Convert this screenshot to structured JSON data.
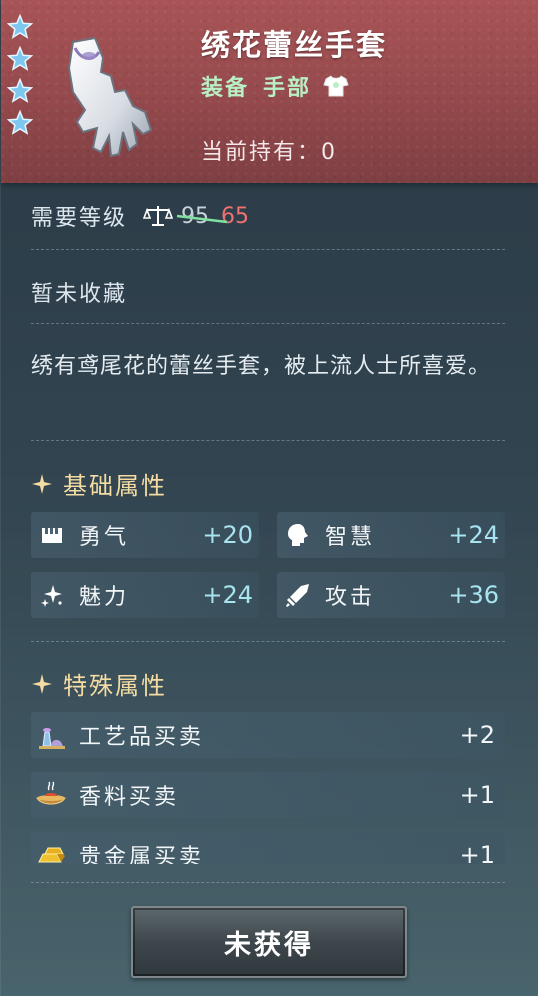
{
  "item": {
    "name": "绣花蕾丝手套",
    "type_main": "装备",
    "type_sub": "手部",
    "owned_label": "当前持有：",
    "owned_count": "0",
    "stars": 4
  },
  "level": {
    "label": "需要等级",
    "original": "95",
    "required": "65"
  },
  "collect_status": "暂未收藏",
  "description": "绣有鸢尾花的蕾丝手套，被上流人士所喜爱。",
  "base_attributes": {
    "title": "基础属性",
    "stats": [
      {
        "name": "勇气",
        "value": "+20",
        "icon": "courage-icon"
      },
      {
        "name": "智慧",
        "value": "+24",
        "icon": "wisdom-icon"
      },
      {
        "name": "魅力",
        "value": "+24",
        "icon": "charm-icon"
      },
      {
        "name": "攻击",
        "value": "+36",
        "icon": "sword-icon"
      }
    ]
  },
  "special_attributes": {
    "title": "特殊属性",
    "trades": [
      {
        "name": "工艺品买卖",
        "value": "+2",
        "icon": "craft-icon"
      },
      {
        "name": "香料买卖",
        "value": "+1",
        "icon": "spice-icon"
      },
      {
        "name": "贵金属买卖",
        "value": "+1",
        "icon": "gold-icon"
      }
    ]
  },
  "button_label": "未获得",
  "colors": {
    "header": "#94494c",
    "type_text": "#b8f0c4",
    "level_new": "#f07070",
    "section_title": "#f4dca2",
    "stat_value": "#a8e4f0"
  }
}
